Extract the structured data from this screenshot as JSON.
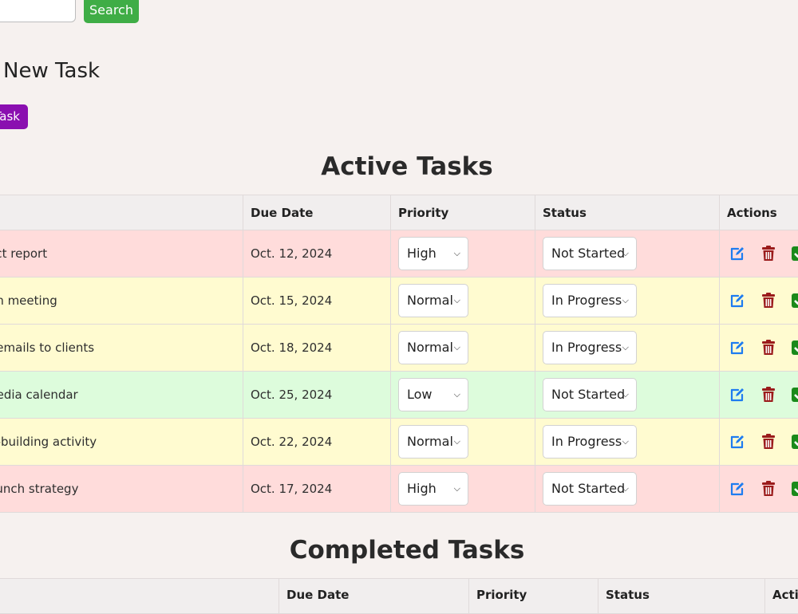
{
  "search": {
    "button_label": "Search",
    "placeholder": ""
  },
  "new_task": {
    "heading": "New Task",
    "button_label": "Task"
  },
  "active": {
    "title": "Active Tasks",
    "columns": {
      "task": "",
      "due": "Due Date",
      "priority": "Priority",
      "status": "Status",
      "actions": "Actions"
    },
    "rows": [
      {
        "task": "ject report",
        "due": "Oct. 12, 2024",
        "priority": "High",
        "status": "Not Started"
      },
      {
        "task": "am meeting",
        "due": "Oct. 15, 2024",
        "priority": "Normal",
        "status": "In Progress"
      },
      {
        "task": "p emails to clients",
        "due": "Oct. 18, 2024",
        "priority": "Normal",
        "status": "In Progress"
      },
      {
        "task": "media calendar",
        "due": "Oct. 25, 2024",
        "priority": "Low",
        "status": "Not Started"
      },
      {
        "task": "m-building activity",
        "due": "Oct. 22, 2024",
        "priority": "Normal",
        "status": "In Progress"
      },
      {
        "task": "launch strategy",
        "due": "Oct. 17, 2024",
        "priority": "High",
        "status": "Not Started"
      }
    ]
  },
  "completed": {
    "title": "Completed Tasks",
    "columns": {
      "task": "",
      "due": "Due Date",
      "priority": "Priority",
      "status": "Status",
      "actions": "Actio"
    }
  },
  "icons": {
    "edit": "edit-icon",
    "delete": "trash-icon",
    "complete": "check-square-icon"
  },
  "colors": {
    "search_button": "#3fad46",
    "add_task_button": "#8a0fb0",
    "high_row": "#ffdcdb",
    "normal_row": "#fffbd0",
    "low_row": "#ddfcdc",
    "edit_icon": "#1e7cf0",
    "delete_icon": "#9b1b1b",
    "complete_icon": "#1a8a1a"
  }
}
